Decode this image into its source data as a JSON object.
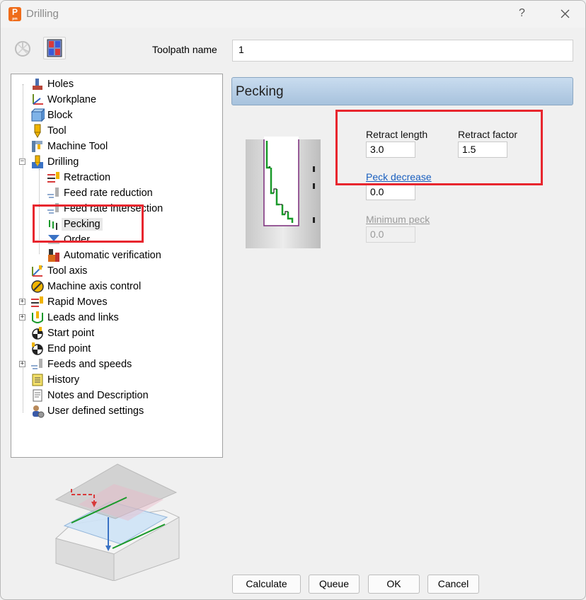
{
  "window": {
    "title": "Drilling",
    "app_icon_letter": "P",
    "app_icon_sub": "pm",
    "help_label": "?",
    "close_icon": "close-icon"
  },
  "toolbar": {
    "toolpath_name_label": "Toolpath name",
    "toolpath_name_value": "1"
  },
  "tree": {
    "items": [
      {
        "label": "Holes",
        "icon": "holes-icon"
      },
      {
        "label": "Workplane",
        "icon": "workplane-icon"
      },
      {
        "label": "Block",
        "icon": "block-icon"
      },
      {
        "label": "Tool",
        "icon": "tool-icon"
      },
      {
        "label": "Machine Tool",
        "icon": "machine-tool-icon"
      },
      {
        "label": "Drilling",
        "icon": "drilling-icon"
      },
      {
        "label": "Retraction",
        "icon": "retraction-icon"
      },
      {
        "label": "Feed rate reduction",
        "icon": "feed-rate-reduction-icon"
      },
      {
        "label": "Feed rate intersection",
        "icon": "feed-rate-intersection-icon"
      },
      {
        "label": "Pecking",
        "icon": "pecking-icon"
      },
      {
        "label": "Order",
        "icon": "order-icon"
      },
      {
        "label": "Automatic verification",
        "icon": "automatic-verification-icon"
      },
      {
        "label": "Tool axis",
        "icon": "tool-axis-icon"
      },
      {
        "label": "Machine axis control",
        "icon": "machine-axis-control-icon"
      },
      {
        "label": "Rapid Moves",
        "icon": "rapid-moves-icon"
      },
      {
        "label": "Leads and links",
        "icon": "leads-and-links-icon"
      },
      {
        "label": "Start point",
        "icon": "start-point-icon"
      },
      {
        "label": "End point",
        "icon": "end-point-icon"
      },
      {
        "label": "Feeds and speeds",
        "icon": "feeds-and-speeds-icon"
      },
      {
        "label": "History",
        "icon": "history-icon"
      },
      {
        "label": "Notes and Description",
        "icon": "notes-icon"
      },
      {
        "label": "User defined settings",
        "icon": "user-settings-icon"
      }
    ]
  },
  "pecking": {
    "section_title": "Pecking",
    "retract_length_label": "Retract length",
    "retract_length_value": "3.0",
    "retract_factor_label": "Retract factor",
    "retract_factor_value": "1.5",
    "peck_decrease_label": "Peck decrease",
    "peck_decrease_value": "0.0",
    "minimum_peck_label": "Minimum peck",
    "minimum_peck_value": "0.0"
  },
  "buttons": {
    "calculate": "Calculate",
    "queue": "Queue",
    "ok": "OK",
    "cancel": "Cancel"
  },
  "colors": {
    "highlight_box": "#e8262e",
    "header_gradient_top": "#c9dcef",
    "header_gradient_bottom": "#a7c2dd",
    "link": "#1a5fbf"
  }
}
